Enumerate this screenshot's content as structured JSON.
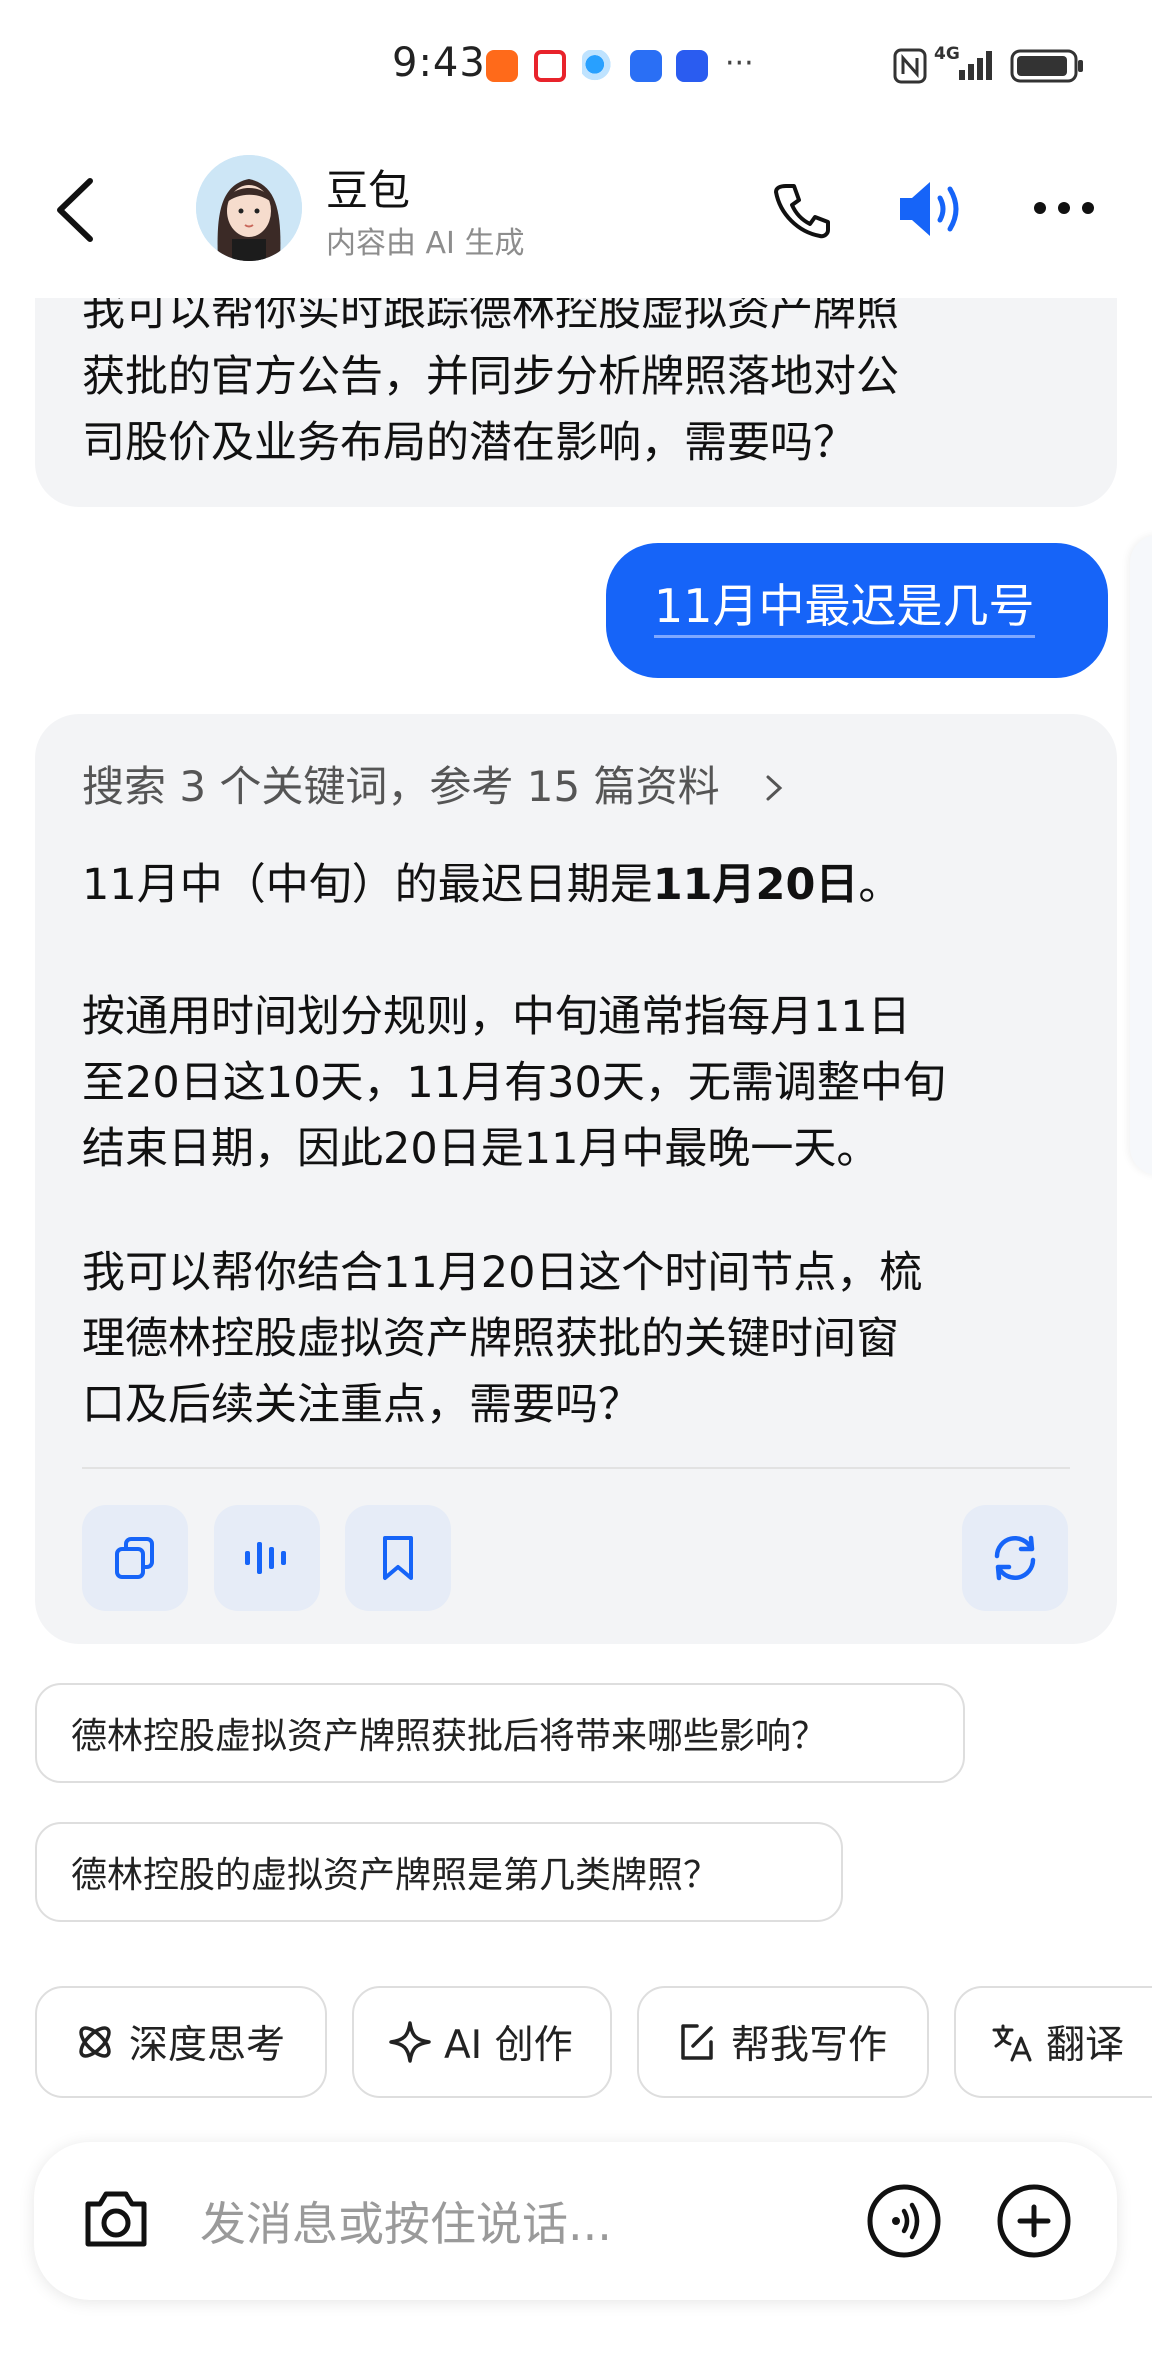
{
  "status_bar": {
    "time": "9:43",
    "notification_icons": [
      "shopping-app-icon",
      "red-app-icon",
      "browser-app-icon",
      "blue-app-icon",
      "news-app-icon"
    ],
    "more": "···",
    "network": "4G"
  },
  "header": {
    "bot_name": "豆包",
    "subtitle": "内容由 AI 生成"
  },
  "messages": {
    "prev_ai_lines": [
      "我可以帮你实时跟踪德林控股虚拟资产牌照",
      "获批的官方公告，并同步分析牌照落地对公",
      "司股价及业务布局的潜在影响，需要吗？"
    ],
    "user_message": "11月中最迟是几号",
    "search_summary": "搜索 3 个关键词，参考 15 篇资料",
    "answer_p1_prefix": "11月中（中旬）的最迟日期是",
    "answer_p1_bold": "11月20日",
    "answer_p1_suffix": "。",
    "answer_p2_lines": [
      "按通用时间划分规则，中旬通常指每月11日",
      "至20日这10天，11月有30天，无需调整中旬",
      "结束日期，因此20日是11月中最晚一天。"
    ],
    "answer_p3_lines": [
      "我可以帮你结合11月20日这个时间节点，梳",
      "理德林控股虚拟资产牌照获批的关键时间窗",
      "口及后续关注重点，需要吗？"
    ]
  },
  "suggestions": [
    "德林控股虚拟资产牌照获批后将带来哪些影响？",
    "德林控股的虚拟资产牌照是第几类牌照？"
  ],
  "chips": [
    {
      "label": "深度思考",
      "icon": "atom-icon"
    },
    {
      "label": "AI 创作",
      "icon": "sparkle-icon"
    },
    {
      "label": "帮我写作",
      "icon": "edit-icon"
    },
    {
      "label": "翻译",
      "icon": "translate-icon"
    }
  ],
  "input": {
    "placeholder": "发消息或按住说话..."
  },
  "colors": {
    "accent": "#1664f8",
    "bubble_gray": "#f3f4f6",
    "action_bg": "#e6ecf7"
  }
}
